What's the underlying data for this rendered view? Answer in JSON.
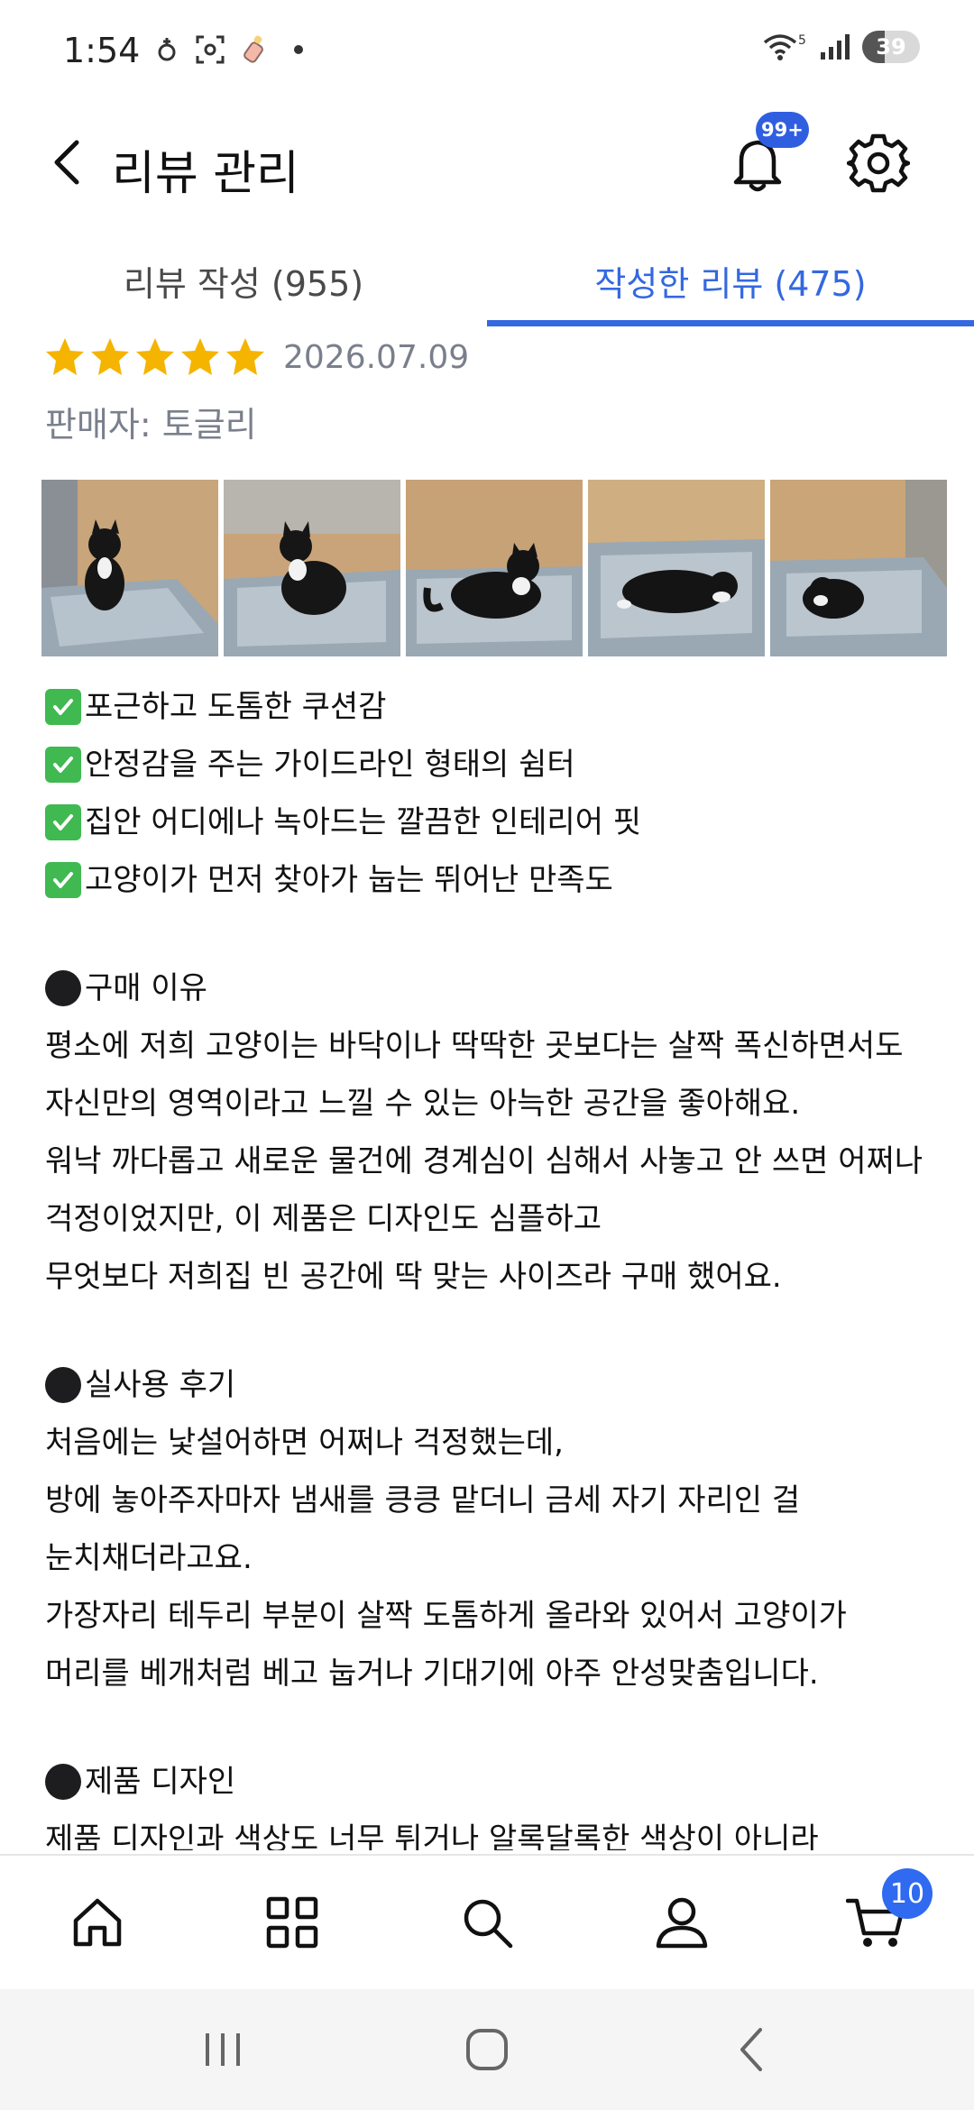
{
  "status_bar": {
    "time": "1:54",
    "network_label": "5",
    "battery_level": "39"
  },
  "header": {
    "title": "리뷰 관리",
    "notification_badge": "99+"
  },
  "tabs": [
    {
      "label": "리뷰 작성 (955)",
      "active": false
    },
    {
      "label": "작성한 리뷰 (475)",
      "active": true
    }
  ],
  "review": {
    "rating": 5,
    "rating_max": 5,
    "date": "2026.07.09",
    "seller": "판매자: 토글리",
    "photo_count_visible": 5,
    "highlights": [
      "포근하고 도톰한 쿠션감",
      "안정감을 주는 가이드라인 형태의 쉼터",
      "집안 어디에나 녹아드는 깔끔한 인테리어 핏",
      "고양이가 먼저 찾아가 눕는 뛰어난 만족도"
    ],
    "section1_title": "구매 이유",
    "section1_lines": [
      "평소에 저희 고양이는 바닥이나 딱딱한 곳보다는 살짝 폭신하면서도",
      "자신만의 영역이라고 느낄 수 있는 아늑한 공간을 좋아해요.",
      "워낙 까다롭고 새로운 물건에 경계심이 심해서 사놓고 안 쓰면 어쩌나",
      "걱정이었지만, 이 제품은 디자인도 심플하고",
      "무엇보다 저희집 빈 공간에 딱 맞는 사이즈라 구매 했어요."
    ],
    "section2_title": "실사용 후기",
    "section2_lines": [
      "처음에는 낯설어하면 어쩌나 걱정했는데,",
      "방에 놓아주자마자 냄새를 킁킁 맡더니 금세 자기 자리인 걸",
      "눈치채더라고요.",
      "가장자리 테두리 부분이 살짝 도톰하게 올라와 있어서 고양이가",
      "머리를 베개처럼 베고 눕거나 기대기에 아주 안성맞춤입니다."
    ],
    "section3_title": "제품 디자인",
    "section3_lines": [
      "제품 디자인과 색상도 너무 튀거나 알록달록한 색상이 아니라"
    ]
  },
  "bottom_nav": {
    "items": [
      "home-icon",
      "category-grid-icon",
      "search-icon",
      "account-icon",
      "cart-icon"
    ],
    "cart_badge": "10"
  },
  "colors": {
    "accent": "#3468e0",
    "star": "#f5b400",
    "meta_text": "#7a7f8c",
    "check_green": "#3fb950"
  }
}
